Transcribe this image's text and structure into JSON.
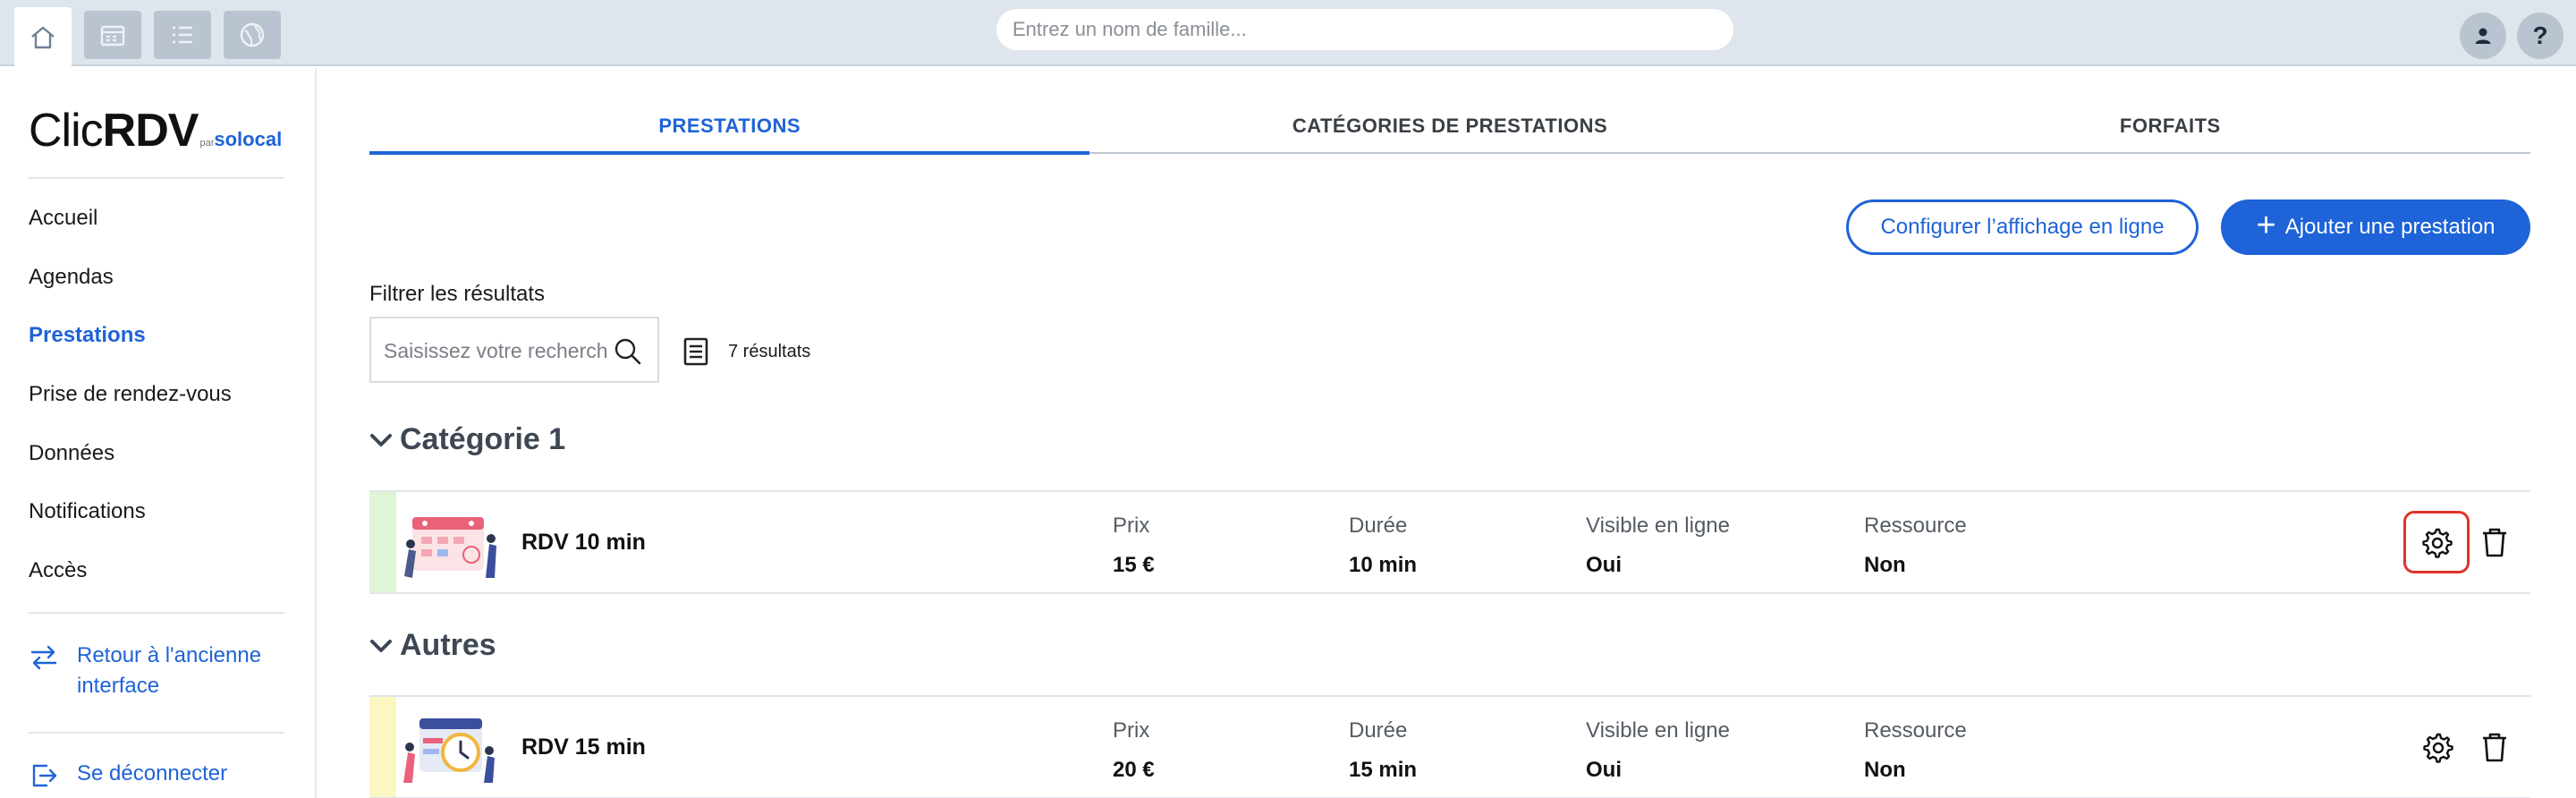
{
  "topbar": {
    "search_placeholder": "Entrez un nom de famille...",
    "user_icon": "user-icon",
    "help_label": "?"
  },
  "logo": {
    "clic": "Clic",
    "rdv": "RDV",
    "par": "par",
    "solocal": "solocal"
  },
  "sidebar": {
    "items": [
      {
        "label": "Accueil"
      },
      {
        "label": "Agendas"
      },
      {
        "label": "Prestations"
      },
      {
        "label": "Prise de rendez-vous"
      },
      {
        "label": "Données"
      },
      {
        "label": "Notifications"
      },
      {
        "label": "Accès"
      }
    ],
    "back_link": "Retour à l'ancienne interface",
    "logout": "Se déconnecter"
  },
  "tabs": [
    {
      "label": "PRESTATIONS"
    },
    {
      "label": "CATÉGORIES DE PRESTATIONS"
    },
    {
      "label": "FORFAITS"
    }
  ],
  "actions": {
    "configure_label": "Configurer l’affichage en ligne",
    "add_label": "Ajouter une prestation",
    "add_plus": "+"
  },
  "filter": {
    "label": "Filtrer les résultats",
    "placeholder": "Saisissez votre recherche",
    "results": "7 résultats"
  },
  "columns": {
    "price": "Prix",
    "duration": "Durée",
    "visible": "Visible en ligne",
    "resource": "Ressource"
  },
  "categories": [
    {
      "name": "Catégorie 1",
      "color": "#dff5d6",
      "services": [
        {
          "name": "RDV 10 min",
          "price": "15 €",
          "duration": "10 min",
          "visible": "Oui",
          "resource": "Non"
        }
      ]
    },
    {
      "name": "Autres",
      "color": "#fbf6c2",
      "services": [
        {
          "name": "RDV 15 min",
          "price": "20 €",
          "duration": "15 min",
          "visible": "Oui",
          "resource": "Non"
        }
      ]
    }
  ],
  "colors": {
    "accent": "#1e63d7",
    "highlight": "#e0332a"
  }
}
